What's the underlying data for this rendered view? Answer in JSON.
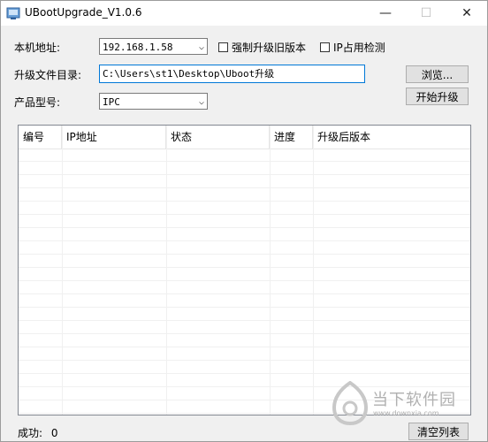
{
  "window": {
    "title": "UBootUpgrade_V1.0.6",
    "minimize_glyph": "—",
    "maximize_glyph": "☐",
    "close_glyph": "✕"
  },
  "form": {
    "local_address_label": "本机地址:",
    "local_address_value": "192.168.1.58",
    "force_upgrade_label": "强制升级旧版本",
    "ip_check_label": "IP占用检测",
    "upgrade_dir_label": "升级文件目录:",
    "upgrade_dir_value": "C:\\Users\\st1\\Desktop\\Uboot升级",
    "product_model_label": "产品型号:",
    "product_model_value": "IPC",
    "browse_button": "浏览...",
    "start_button": "开始升级"
  },
  "table": {
    "columns": [
      "编号",
      "IP地址",
      "状态",
      "进度",
      "升级后版本"
    ],
    "rows": []
  },
  "status": {
    "success_label": "成功:",
    "success_count": "0",
    "clear_button": "清空列表"
  },
  "watermark": {
    "text": "当下软件园",
    "sub": "www.downxia.com"
  },
  "colors": {
    "accent_border": "#0078d7",
    "window_bg": "#f0f0f0",
    "watermark": "#b0b0b0"
  },
  "icons": {
    "app": "app-icon",
    "dropdown": "chevron-down-icon",
    "watermark_logo": "logo-icon"
  }
}
